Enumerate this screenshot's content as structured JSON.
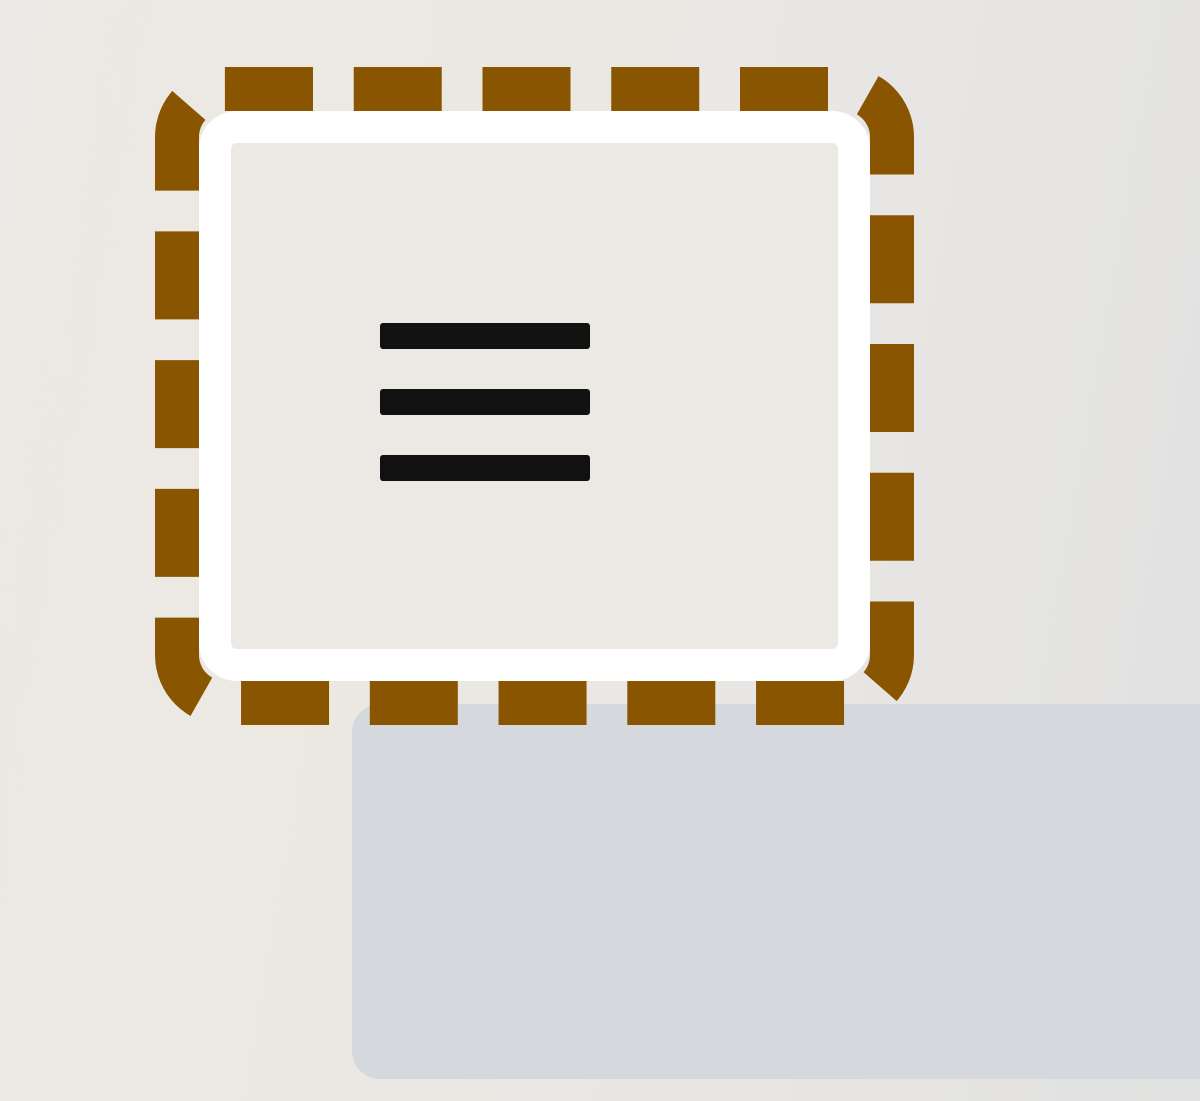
{
  "menu_button": {
    "icon": "hamburger-menu-icon",
    "focused": true
  },
  "colors": {
    "focus_ring": "#8a5500",
    "button_outline": "#ffffff",
    "button_fill": "#ece8e3",
    "icon": "#111111",
    "panel": "#d5d8dd",
    "background": "#ebe9e5"
  }
}
